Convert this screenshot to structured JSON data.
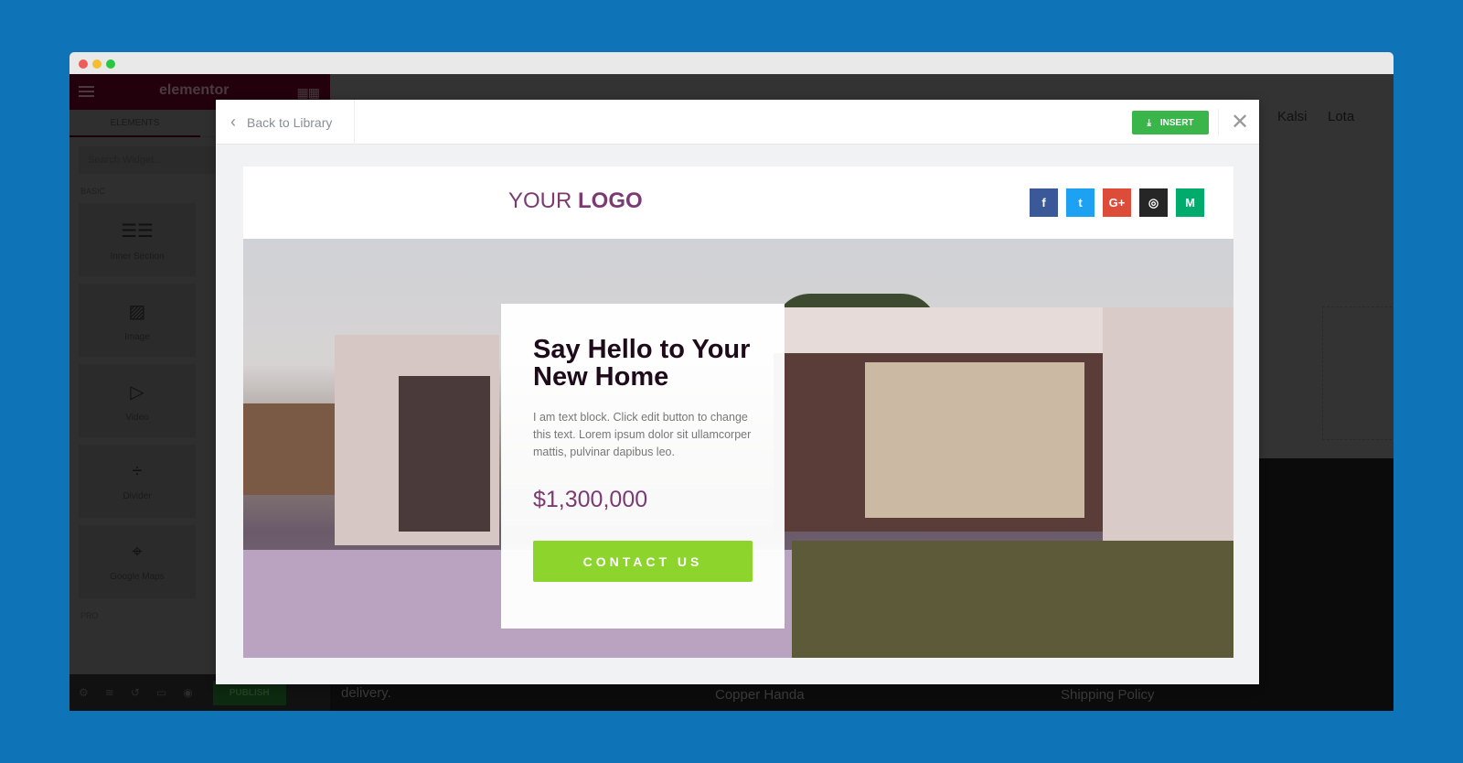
{
  "window": {
    "dots": [
      "#ed5e57",
      "#f5bd2f",
      "#28c840"
    ]
  },
  "sidebar": {
    "brand": "elementor",
    "tab": "ELEMENTS",
    "search_placeholder": "Search Widget...",
    "section_basic": "BASIC",
    "section_pro": "PRO",
    "widgets": [
      {
        "label": "Inner Section",
        "icon": "columns-icon"
      },
      {
        "label": "Image",
        "icon": "image-icon"
      },
      {
        "label": "Video",
        "icon": "video-icon"
      },
      {
        "label": "Divider",
        "icon": "divider-icon"
      },
      {
        "label": "Google Maps",
        "icon": "map-icon"
      }
    ],
    "publish": "PUBLISH"
  },
  "page": {
    "nav": [
      "Kalsi",
      "Lota"
    ],
    "footer_text": "delivery.",
    "footer_links": [
      "Copper Handa",
      "Shipping Policy"
    ]
  },
  "modal": {
    "back_label": "Back to Library",
    "insert_label": "INSERT",
    "template": {
      "logo_light": "YOUR ",
      "logo_bold": "LOGO",
      "social": [
        {
          "icon": "facebook-icon",
          "glyph": "f",
          "color": "#3b5998"
        },
        {
          "icon": "twitter-icon",
          "glyph": "t",
          "color": "#1da1f2"
        },
        {
          "icon": "google-plus-icon",
          "glyph": "G+",
          "color": "#dd4b39"
        },
        {
          "icon": "instagram-icon",
          "glyph": "◎",
          "color": "#262626"
        },
        {
          "icon": "medium-icon",
          "glyph": "M",
          "color": "#00ab6c"
        }
      ],
      "heading": "Say Hello to Your New Home",
      "body": "I am text block. Click edit button to change this text. Lorem ipsum dolor sit ullamcorper mattis, pulvinar dapibus leo.",
      "price": "$1,300,000",
      "cta": "CONTACT US"
    }
  },
  "colors": {
    "accent_green": "#39b54a",
    "cta_green": "#8dd42d",
    "brand_purple": "#7b3b72"
  }
}
